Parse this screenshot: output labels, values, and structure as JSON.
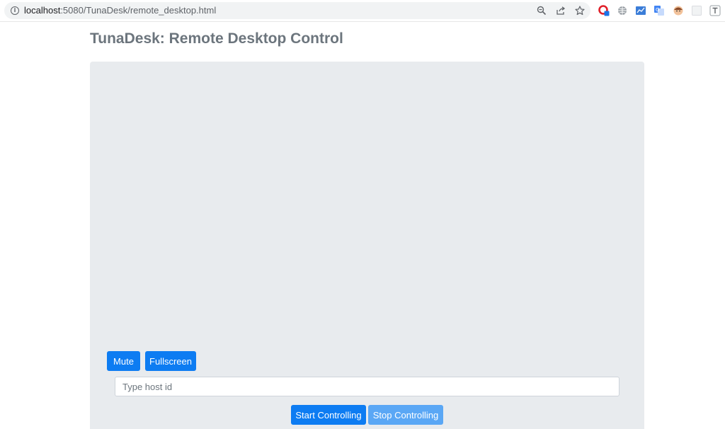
{
  "browser": {
    "url_host": "localhost",
    "url_path": ":5080/TunaDesk/remote_desktop.html",
    "icons": [
      "info-icon",
      "zoom-icon",
      "share-icon",
      "bookmark-star-icon"
    ],
    "extensions": [
      "opera-extension-icon",
      "globe-extension-icon",
      "metrics-extension-icon",
      "translate-extension-icon",
      "avatar-extension-icon",
      "blank-extension-icon",
      "text-extension-icon"
    ]
  },
  "page": {
    "title": "TunaDesk: Remote Desktop Control"
  },
  "controls": {
    "mute_label": "Mute",
    "fullscreen_label": "Fullscreen",
    "host_input_placeholder": "Type host id",
    "host_input_value": "",
    "start_label": "Start Controlling",
    "stop_label": "Stop Controlling"
  },
  "colors": {
    "primary": "#0d7cf2",
    "primary_disabled": "#5aa7f5",
    "panel_bg": "#e8ebee",
    "title": "#6c757d"
  }
}
